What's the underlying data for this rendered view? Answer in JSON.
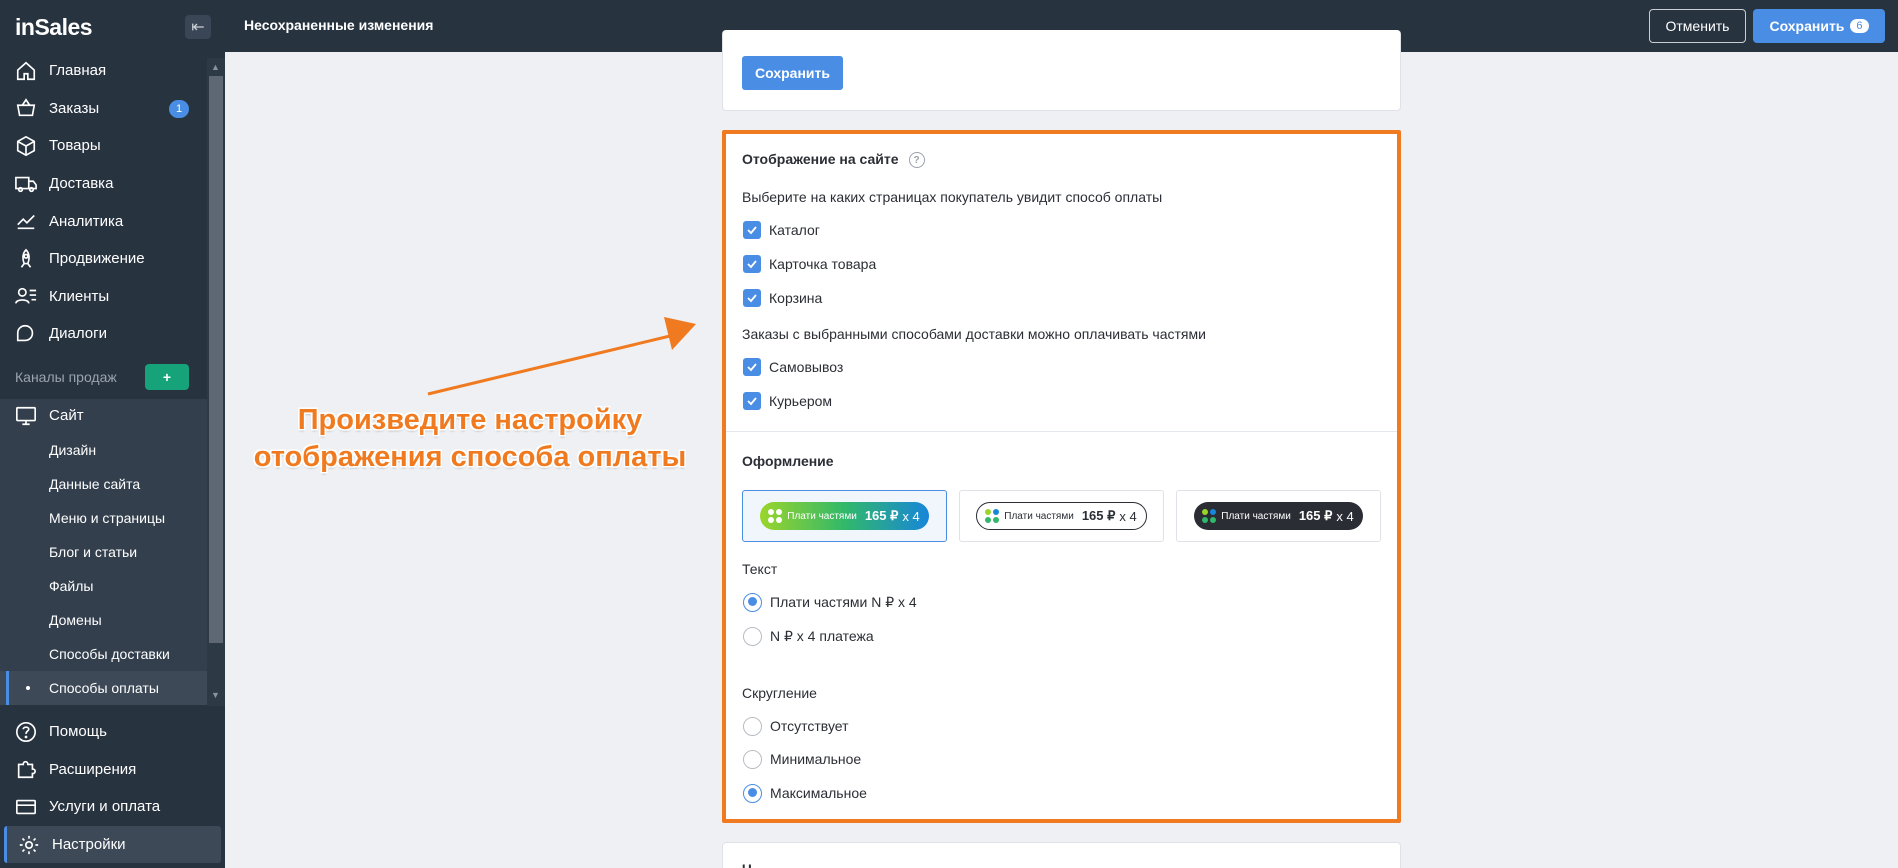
{
  "app": {
    "logo": "inSales",
    "collapse_icon": "←|"
  },
  "sidebar": {
    "items": [
      {
        "label": "Главная",
        "icon": "home-icon"
      },
      {
        "label": "Заказы",
        "icon": "basket-icon",
        "badge": "1"
      },
      {
        "label": "Товары",
        "icon": "box-icon"
      },
      {
        "label": "Доставка",
        "icon": "truck-icon"
      },
      {
        "label": "Аналитика",
        "icon": "chart-icon"
      },
      {
        "label": "Продвижение",
        "icon": "rocket-icon"
      },
      {
        "label": "Клиенты",
        "icon": "clients-icon"
      },
      {
        "label": "Диалоги",
        "icon": "chat-icon"
      }
    ],
    "channels_label": "Каналы продаж",
    "channels_add": "+",
    "site": {
      "label": "Сайт",
      "subitems": [
        {
          "label": "Дизайн"
        },
        {
          "label": "Данные сайта"
        },
        {
          "label": "Меню и страницы"
        },
        {
          "label": "Блог и статьи"
        },
        {
          "label": "Файлы"
        },
        {
          "label": "Домены"
        },
        {
          "label": "Способы доставки"
        },
        {
          "label": "Способы оплаты",
          "active": true
        }
      ]
    },
    "bottom": [
      {
        "label": "Помощь",
        "icon": "help-icon"
      },
      {
        "label": "Расширения",
        "icon": "puzzle-icon"
      },
      {
        "label": "Услуги и оплата",
        "icon": "card-icon"
      },
      {
        "label": "Настройки",
        "icon": "gear-icon",
        "active": true
      }
    ]
  },
  "topbar": {
    "status": "Несохраненные изменения",
    "cancel_label": "Отменить",
    "save_label": "Сохранить",
    "save_count": "6"
  },
  "prev_card": {
    "save_label": "Сохранить"
  },
  "display": {
    "title": "Отображение на сайте",
    "pages_prompt": "Выберите на каких страницах покупатель увидит способ оплаты",
    "pages": [
      {
        "label": "Каталог",
        "checked": true
      },
      {
        "label": "Карточка товара",
        "checked": true
      },
      {
        "label": "Корзина",
        "checked": true
      }
    ],
    "delivery_prompt": "Заказы с выбранными способами доставки можно оплачивать частями",
    "delivery": [
      {
        "label": "Самовывоз",
        "checked": true
      },
      {
        "label": "Курьером",
        "checked": true
      }
    ]
  },
  "design": {
    "title": "Оформление",
    "widget": {
      "brand": "Плати частями",
      "amount": "165 ₽",
      "multiplier": "x 4"
    },
    "styles": [
      {
        "name": "gradient",
        "selected": true
      },
      {
        "name": "outline",
        "selected": false
      },
      {
        "name": "dark",
        "selected": false
      }
    ],
    "text_label": "Текст",
    "text_options": [
      {
        "label": "Плати частями N ₽ x 4",
        "selected": true
      },
      {
        "label": "N ₽ x 4 платежа",
        "selected": false
      }
    ],
    "rounding_label": "Скругление",
    "rounding_options": [
      {
        "label": "Отсутствует",
        "selected": false
      },
      {
        "label": "Минимальное",
        "selected": false
      },
      {
        "label": "Максимальное",
        "selected": true
      }
    ]
  },
  "next_card": {
    "title": "Ч"
  },
  "annotation": {
    "line1": "Произведите настройку",
    "line2": "отображения способа оплаты",
    "color": "#f07a1f"
  }
}
